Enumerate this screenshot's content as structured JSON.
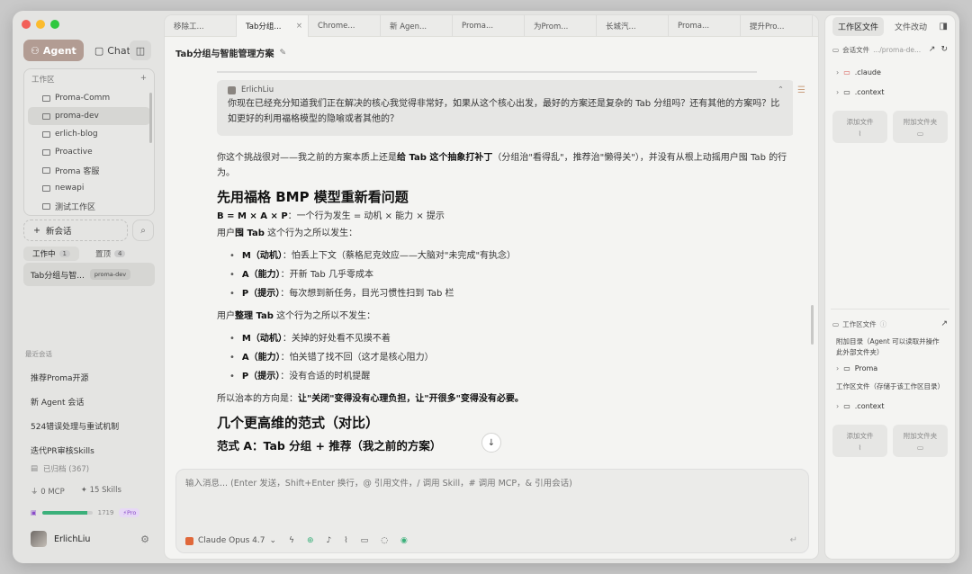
{
  "sidebar": {
    "mode_agent": "Agent",
    "mode_chat": "Chat",
    "workspace_label": "工作区",
    "workspaces": [
      "Proma-Comm",
      "proma-dev",
      "erlich-blog",
      "Proactive",
      "Proma 客服",
      "newapi",
      "测试工作区"
    ],
    "new_chat": "新会话",
    "seg_active": "工作中",
    "seg_active_count": "1",
    "seg_pinned": "置顶",
    "seg_pinned_count": "4",
    "session_title": "Tab分组与智...",
    "session_tag": "proma-dev",
    "recent_label": "最近会话",
    "recent": [
      "推荐Proma开源",
      "新 Agent 会话",
      "524错误处理与重试机制",
      "迭代PR审核Skills"
    ],
    "archived": "已归档 (367)",
    "mcp": "0 MCP",
    "skills": "15 Skills",
    "usage_value": "1719",
    "usage_progress": 0.9,
    "pro": "Pro",
    "username": "ErlichLiu"
  },
  "tabs": [
    {
      "label": "移除工...",
      "active": false
    },
    {
      "label": "Tab分组...",
      "active": true
    },
    {
      "label": "Chrome...",
      "active": false
    },
    {
      "label": "新 Agen...",
      "active": false
    },
    {
      "label": "Proma...",
      "active": false
    },
    {
      "label": "为Prom...",
      "active": false
    },
    {
      "label": "长城汽...",
      "active": false
    },
    {
      "label": "Proma...",
      "active": false
    },
    {
      "label": "提升Pro...",
      "active": false
    }
  ],
  "main": {
    "title": "Tab分组与智能管理方案",
    "quote_author": "ErlichLiu",
    "quote_text": "你现在已经充分知道我们正在解决的核心我觉得非常好，如果从这个核心出发，最好的方案还是复杂的 Tab 分组吗？还有其他的方案吗？比如更好的利用福格模型的隐喻或者其他的？",
    "intro_a": "你这个挑战很对——我之前的方案本质上还是",
    "intro_b": "给 Tab 这个抽象打补丁",
    "intro_c": "（分组治\"看得乱\"，推荐治\"懒得关\"），并没有从根上动摇用户囤 Tab 的行为。",
    "h_fogg": "先用福格 BMP 模型重新看问题",
    "formula_b": "B = M × A × P",
    "formula_rest": "：一个行为发生 = 动机 × 能力 × 提示",
    "hoard_a": "用户",
    "hoard_b": "囤 Tab",
    "hoard_c": " 这个行为之所以发生：",
    "hoard_items": [
      {
        "k": "M（动机）",
        "v": "：怕丢上下文（蔡格尼克效应——大脑对\"未完成\"有执念）"
      },
      {
        "k": "A（能力）",
        "v": "：开新 Tab 几乎零成本"
      },
      {
        "k": "P（提示）",
        "v": "：每次想到新任务，目光习惯性扫到 Tab 栏"
      }
    ],
    "tidy_a": "用户",
    "tidy_b": "整理 Tab",
    "tidy_c": " 这个行为之所以不发生：",
    "tidy_items": [
      {
        "k": "M（动机）",
        "v": "：关掉的好处看不见摸不着"
      },
      {
        "k": "A（能力）",
        "v": "：怕关错了找不回（这才是核心阻力）"
      },
      {
        "k": "P（提示）",
        "v": "：没有合适的时机提醒"
      }
    ],
    "direction_a": "所以治本的方向是：",
    "direction_b": "让\"关闭\"变得没有心理负担，让\"开很多\"变得没有必要。",
    "h_paradigm": "几个更高维的范式（对比）",
    "h_a": "范式 A：Tab 分组 + 推荐（我之前的方案）"
  },
  "composer": {
    "placeholder": "输入消息... (Enter 发送，Shift+Enter 换行，@ 引用文件，/ 调用 Skill，# 调用 MCP，& 引用会话)",
    "model": "Claude Opus 4.7"
  },
  "rpanel": {
    "tab_files": "工作区文件",
    "tab_changes": "文件改动",
    "session_files": "会话文件",
    "session_path": ".../proma-de...",
    "session_items": [
      ".claude",
      ".context"
    ],
    "add_file": "添加文件",
    "add_folder": "附加文件夹",
    "ws_files": "工作区文件",
    "attach_note": "附加目录（Agent 可以读取并操作此外部文件夹）",
    "attach_item": "Proma",
    "ws_note": "工作区文件（存储于该工作区目录）",
    "ws_item": ".context"
  },
  "colors": {
    "accent": "#b29c93",
    "close": "#f25f58",
    "min": "#fbbb2e",
    "max": "#30c840",
    "progress": "#3bb07a"
  }
}
